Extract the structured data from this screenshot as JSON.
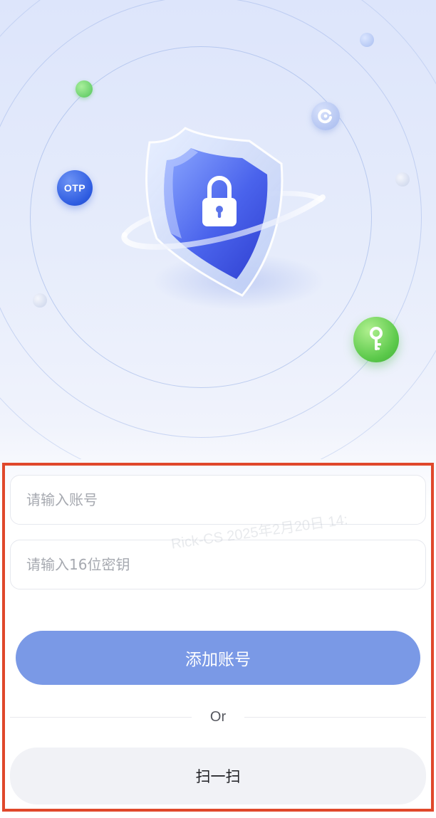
{
  "hero": {
    "otp_badge_label": "OTP",
    "icons": [
      "shield-lock-icon",
      "refresh-icon",
      "key-icon"
    ]
  },
  "form": {
    "account_placeholder": "请输入账号",
    "secret_placeholder": "请输入16位密钥",
    "add_account_label": "添加账号",
    "or_label": "Or",
    "scan_label": "扫一扫"
  },
  "watermark": "Rick-CS 2025年2月20日 14:",
  "colors": {
    "primary_button": "#7a99e6",
    "secondary_button": "#f1f2f6",
    "highlight_frame": "#e0482b",
    "otp_badge": "#2d5be0",
    "key_badge": "#5cc94b"
  }
}
